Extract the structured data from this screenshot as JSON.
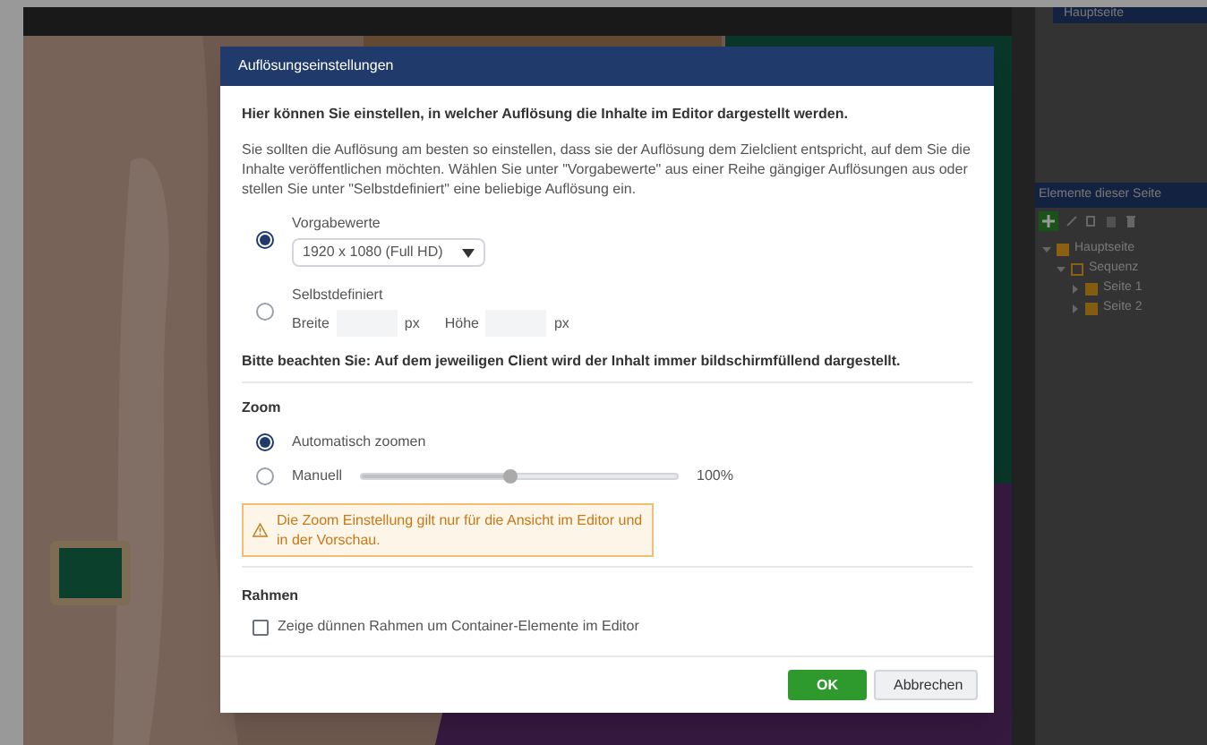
{
  "editor": {
    "pages_panel": {
      "items": [
        {
          "label": "Hauptseite",
          "selected": true
        }
      ]
    },
    "elements_panel": {
      "title": "Elemente dieser Seite",
      "tree": [
        {
          "label": "Hauptseite",
          "kind": "page",
          "expanded": true,
          "children": [
            {
              "label": "Sequenz",
              "kind": "sequence",
              "expanded": true,
              "children": [
                {
                  "label": "Seite 1",
                  "kind": "slide",
                  "expanded": false
                },
                {
                  "label": "Seite 2",
                  "kind": "slide",
                  "expanded": false
                }
              ]
            }
          ]
        }
      ]
    }
  },
  "dialog": {
    "title": "Auflösungseinstellungen",
    "intro": "Hier können Sie einstellen, in welcher Auflösung die Inhalte im Editor dargestellt werden.",
    "description": "Sie sollten die Auflösung am besten so einstellen, dass sie der Auflösung dem Zielclient entspricht, auf dem Sie die Inhalte veröffentlichen möchten. Wählen Sie unter \"Vorgabewerte\" aus einer Reihe gängiger Auflösungen aus oder stellen Sie unter \"Selbstdefiniert\" eine beliebige Auflösung ein.",
    "resolution_options": [
      {
        "kind": "preset",
        "label": "Vorgabewerte",
        "selected": true,
        "value": "1920 x 1080 (Full HD)"
      },
      {
        "kind": "custom",
        "label": "Selbstdefiniert",
        "selected": false,
        "width_label": "Breite",
        "width_unit": "px",
        "height_label": "Höhe",
        "height_unit": "px"
      }
    ],
    "note": "Bitte beachten Sie: Auf dem jeweiligen Client wird der Inhalt immer bildschirmfüllend dargestellt.",
    "zoom": {
      "heading": "Zoom",
      "options": [
        {
          "kind": "auto",
          "label": "Automatisch zoomen",
          "selected": true
        },
        {
          "kind": "manual",
          "label": "Manuell",
          "selected": false,
          "level": 0.47,
          "reading": "100%"
        }
      ],
      "warning": "Die Zoom Einstellung gilt nur für die Ansicht im Editor und in der Vorschau."
    },
    "frame": {
      "heading": "Rahmen",
      "checkbox": {
        "label": "Zeige dünnen Rahmen um Container-Elemente im Editor",
        "checked": false
      }
    },
    "buttons": [
      {
        "label": "OK",
        "kind": "primary"
      },
      {
        "label": "Abbrechen",
        "kind": "secondary"
      }
    ]
  }
}
